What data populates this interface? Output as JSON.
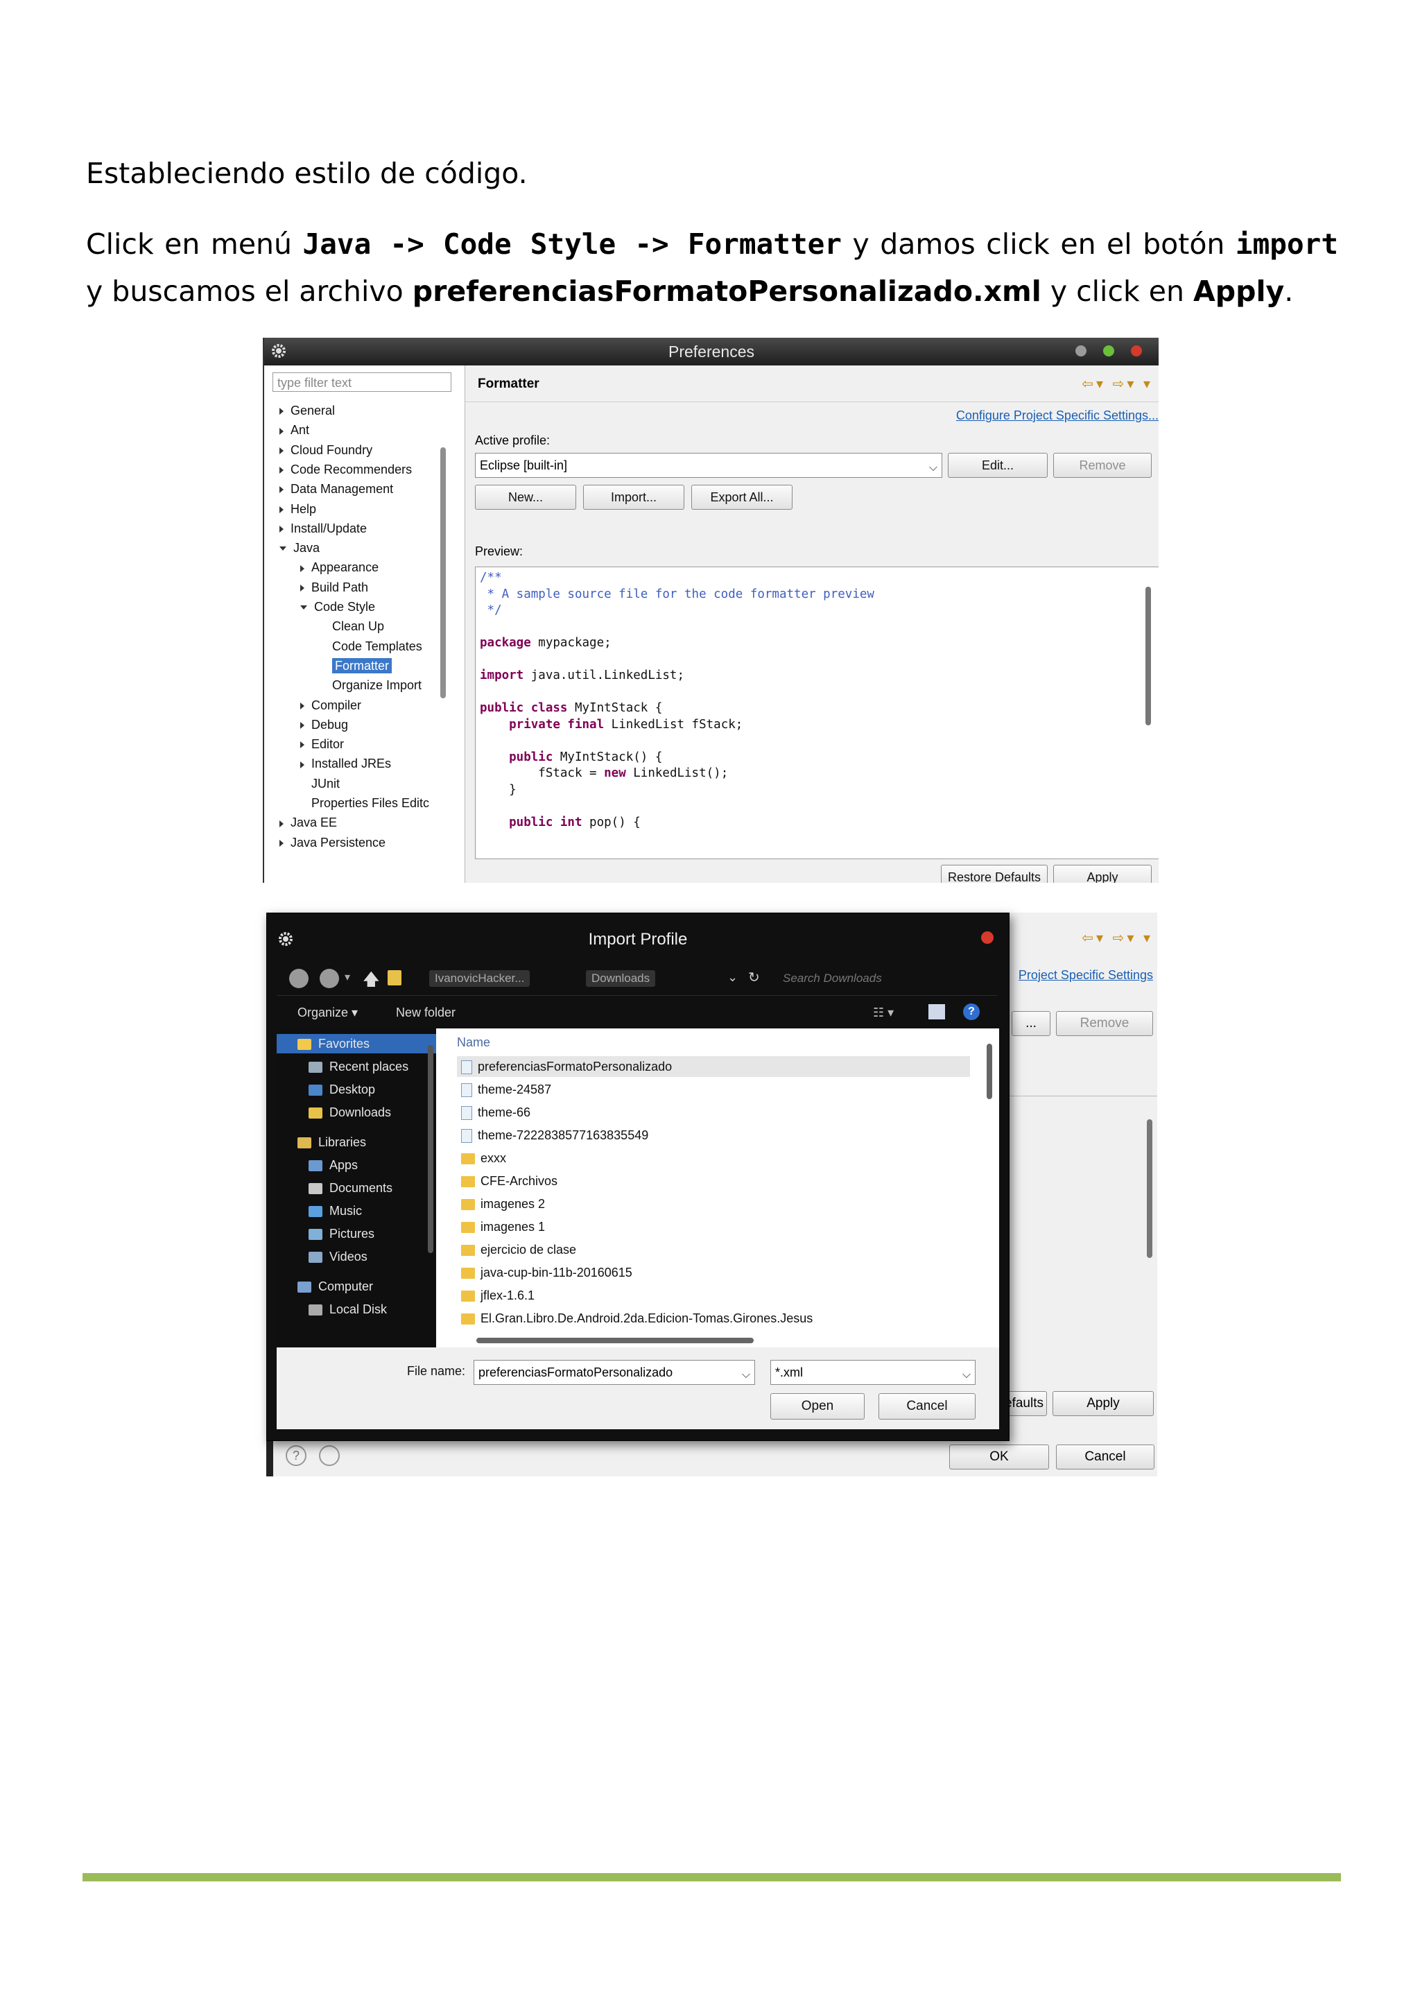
{
  "doc": {
    "heading": "Estableciendo estilo de código.",
    "para": {
      "p1": "Click en menú ",
      "b1": "Java -> Code Style -> Formatter",
      "p2": " y damos click en el botón ",
      "b2": "import",
      "p3": " y buscamos el archivo ",
      "b3": "preferenciasFormatoPersonalizado.xml",
      "p4": " y click en ",
      "b4": "Apply",
      "p5": "."
    }
  },
  "prefs": {
    "title": "Preferences",
    "filter_placeholder": "type filter text",
    "tree": [
      {
        "label": "General",
        "level": 0,
        "tw": "r"
      },
      {
        "label": "Ant",
        "level": 0,
        "tw": "r"
      },
      {
        "label": "Cloud Foundry",
        "level": 0,
        "tw": "r"
      },
      {
        "label": "Code Recommenders",
        "level": 0,
        "tw": "r"
      },
      {
        "label": "Data Management",
        "level": 0,
        "tw": "r"
      },
      {
        "label": "Help",
        "level": 0,
        "tw": "r"
      },
      {
        "label": "Install/Update",
        "level": 0,
        "tw": "r"
      },
      {
        "label": "Java",
        "level": 0,
        "tw": "d"
      },
      {
        "label": "Appearance",
        "level": 1,
        "tw": "r"
      },
      {
        "label": "Build Path",
        "level": 1,
        "tw": "r"
      },
      {
        "label": "Code Style",
        "level": 1,
        "tw": "d"
      },
      {
        "label": "Clean Up",
        "level": 2,
        "tw": ""
      },
      {
        "label": "Code Templates",
        "level": 2,
        "tw": ""
      },
      {
        "label": "Formatter",
        "level": 2,
        "tw": "",
        "selected": true
      },
      {
        "label": "Organize Import",
        "level": 2,
        "tw": ""
      },
      {
        "label": "Compiler",
        "level": 1,
        "tw": "r"
      },
      {
        "label": "Debug",
        "level": 1,
        "tw": "r"
      },
      {
        "label": "Editor",
        "level": 1,
        "tw": "r"
      },
      {
        "label": "Installed JREs",
        "level": 1,
        "tw": "r"
      },
      {
        "label": "JUnit",
        "level": 1,
        "tw": ""
      },
      {
        "label": "Properties Files Editc",
        "level": 1,
        "tw": ""
      },
      {
        "label": "Java EE",
        "level": 0,
        "tw": "r"
      },
      {
        "label": "Java Persistence",
        "level": 0,
        "tw": "r"
      }
    ],
    "section_title": "Formatter",
    "configure_link": "Configure Project Specific Settings...",
    "active_profile_label": "Active profile:",
    "profile_value": "Eclipse [built-in]",
    "edit_btn": "Edit...",
    "remove_btn": "Remove",
    "new_btn": "New...",
    "import_btn": "Import...",
    "export_btn": "Export All...",
    "preview_label": "Preview:",
    "restore_btn": "Restore Defaults",
    "apply_btn": "Apply",
    "code": {
      "l1": "/**",
      "l2": " * A sample source file for the code formatter preview",
      "l3": " */",
      "l4k": "package",
      "l4": " mypackage;",
      "l5k": "import",
      "l5": " java.util.LinkedList;",
      "l6k": "public class",
      "l6": " MyIntStack {",
      "l7k": "    private final",
      "l7": " LinkedList fStack;",
      "l8k": "    public",
      "l8": " MyIntStack() {",
      "l9a": "        fStack = ",
      "l9k": "new",
      "l9b": " LinkedList();",
      "l10": "    }",
      "l11k": "    public int",
      "l11": " pop() {"
    }
  },
  "import_dialog": {
    "title": "Import Profile",
    "crumb1": "IvanovicHacker...",
    "crumb2": "Downloads",
    "search_placeholder": "Search Downloads",
    "organize": "Organize",
    "new_folder": "New folder",
    "nav": [
      {
        "label": "Favorites",
        "indent": 0,
        "color": "#f2c94c",
        "selected": true
      },
      {
        "label": "Recent places",
        "indent": 1,
        "color": "#9ab"
      },
      {
        "label": "Desktop",
        "indent": 1,
        "color": "#4a86c8"
      },
      {
        "label": "Downloads",
        "indent": 1,
        "color": "#e8c14a"
      },
      {
        "label": "Libraries",
        "indent": 0,
        "color": "#e0b850",
        "gap": true
      },
      {
        "label": "Apps",
        "indent": 1,
        "color": "#6a9ad0"
      },
      {
        "label": "Documents",
        "indent": 1,
        "color": "#c8c8c8"
      },
      {
        "label": "Music",
        "indent": 1,
        "color": "#5aa0e0"
      },
      {
        "label": "Pictures",
        "indent": 1,
        "color": "#7fb0d8"
      },
      {
        "label": "Videos",
        "indent": 1,
        "color": "#8aa8c8"
      },
      {
        "label": "Computer",
        "indent": 0,
        "color": "#7aa0d0",
        "gap": true
      },
      {
        "label": "Local Disk",
        "indent": 1,
        "color": "#aaa"
      }
    ],
    "column_name": "Name",
    "files": [
      {
        "label": "preferenciasFormatoPersonalizado",
        "kind": "doc",
        "selected": true
      },
      {
        "label": "theme-24587",
        "kind": "doc"
      },
      {
        "label": "theme-66",
        "kind": "doc"
      },
      {
        "label": "theme-7222838577163835549",
        "kind": "doc"
      },
      {
        "label": "exxx",
        "kind": "fold"
      },
      {
        "label": "CFE-Archivos",
        "kind": "fold"
      },
      {
        "label": "imagenes 2",
        "kind": "fold"
      },
      {
        "label": "imagenes 1",
        "kind": "fold"
      },
      {
        "label": "ejercicio de clase",
        "kind": "fold"
      },
      {
        "label": "java-cup-bin-11b-20160615",
        "kind": "fold"
      },
      {
        "label": "jflex-1.6.1",
        "kind": "fold"
      },
      {
        "label": "El.Gran.Libro.De.Android.2da.Edicion-Tomas.Girones.Jesus",
        "kind": "fold"
      }
    ],
    "filename_label": "File name:",
    "filename_value": "preferenciasFormatoPersonalizado",
    "filetype_value": "*.xml",
    "open_btn": "Open",
    "cancel_btn": "Cancel"
  },
  "behind": {
    "link": "Project Specific Settings",
    "dots_btn": "...",
    "remove_btn": "Remove",
    "defaults_btn": "efaults",
    "apply_btn": "Apply",
    "ok_btn": "OK",
    "cancel_btn": "Cancel"
  },
  "colors": {
    "footer_line": "#9bbb59",
    "selection": "#3b78c9",
    "link": "#1a5fb4"
  }
}
